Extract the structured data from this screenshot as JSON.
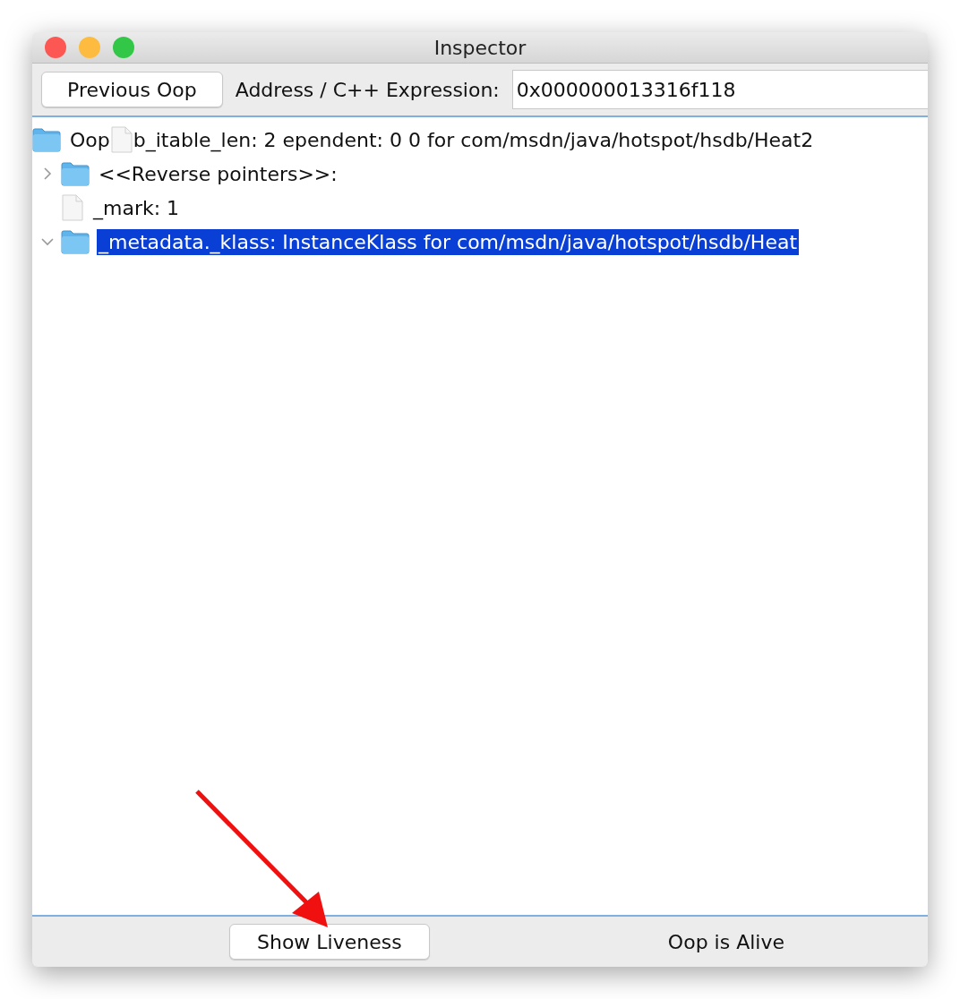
{
  "window": {
    "title": "Inspector"
  },
  "toolbar": {
    "previous_button": "Previous Oop",
    "address_label": "Address / C++ Expression:",
    "address_value": "0x000000013316f118"
  },
  "tree": {
    "root": {
      "kind": "folder",
      "label_start": "Oop",
      "label_end": "b_itable_len: 2 ependent: 0 0 for com/msdn/java/hotspot/hsdb/Heat2",
      "children": [
        {
          "kind": "folder",
          "label": "<<Reverse pointers>>:",
          "expanded": false,
          "selected": false
        },
        {
          "kind": "file",
          "label": "_mark: 1",
          "selected": false
        },
        {
          "kind": "folder",
          "label": "_metadata._klass: InstanceKlass for com/msdn/java/hotspot/hsdb/Heat",
          "expanded": true,
          "selected": true
        }
      ]
    }
  },
  "bottom_bar": {
    "liveness_button": "Show Liveness",
    "status": "Oop is Alive"
  }
}
